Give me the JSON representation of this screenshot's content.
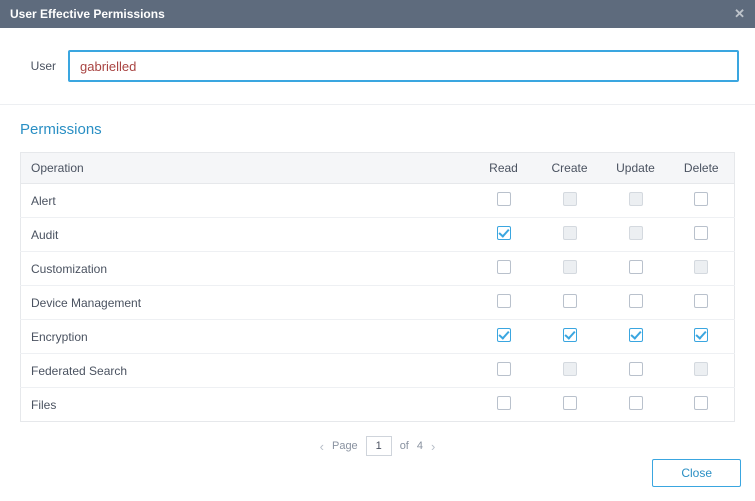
{
  "title": "User Effective Permissions",
  "user": {
    "label": "User",
    "value": "gabrielled"
  },
  "permissions": {
    "section_label": "Permissions",
    "columns": {
      "operation": "Operation",
      "read": "Read",
      "create": "Create",
      "update": "Update",
      "delete": "Delete"
    },
    "rows": [
      {
        "name": "Alert",
        "read": {
          "checked": false,
          "disabled": false
        },
        "create": {
          "checked": false,
          "disabled": true
        },
        "update": {
          "checked": false,
          "disabled": true
        },
        "delete": {
          "checked": false,
          "disabled": false
        }
      },
      {
        "name": "Audit",
        "read": {
          "checked": true,
          "disabled": false
        },
        "create": {
          "checked": false,
          "disabled": true
        },
        "update": {
          "checked": false,
          "disabled": true
        },
        "delete": {
          "checked": false,
          "disabled": false
        }
      },
      {
        "name": "Customization",
        "read": {
          "checked": false,
          "disabled": false
        },
        "create": {
          "checked": false,
          "disabled": true
        },
        "update": {
          "checked": false,
          "disabled": false
        },
        "delete": {
          "checked": false,
          "disabled": true
        }
      },
      {
        "name": "Device Management",
        "read": {
          "checked": false,
          "disabled": false
        },
        "create": {
          "checked": false,
          "disabled": false
        },
        "update": {
          "checked": false,
          "disabled": false
        },
        "delete": {
          "checked": false,
          "disabled": false
        }
      },
      {
        "name": "Encryption",
        "read": {
          "checked": true,
          "disabled": false
        },
        "create": {
          "checked": true,
          "disabled": false
        },
        "update": {
          "checked": true,
          "disabled": false
        },
        "delete": {
          "checked": true,
          "disabled": false
        }
      },
      {
        "name": "Federated Search",
        "read": {
          "checked": false,
          "disabled": false
        },
        "create": {
          "checked": false,
          "disabled": true
        },
        "update": {
          "checked": false,
          "disabled": false
        },
        "delete": {
          "checked": false,
          "disabled": true
        }
      },
      {
        "name": "Files",
        "read": {
          "checked": false,
          "disabled": false
        },
        "create": {
          "checked": false,
          "disabled": false
        },
        "update": {
          "checked": false,
          "disabled": false
        },
        "delete": {
          "checked": false,
          "disabled": false
        }
      }
    ]
  },
  "pager": {
    "label": "Page",
    "current": "1",
    "of_label": "of",
    "total": "4"
  },
  "footer": {
    "close": "Close"
  }
}
